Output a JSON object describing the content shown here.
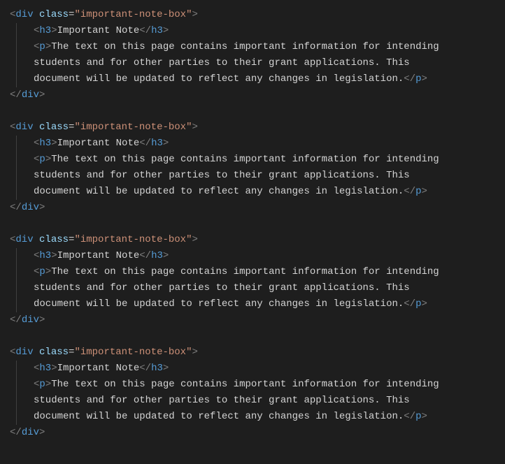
{
  "tags": {
    "div": "div",
    "h3": "h3",
    "p": "p"
  },
  "attrs": {
    "class": "class"
  },
  "strings": {
    "important_note_box": "\"important-note-box\""
  },
  "content": {
    "heading": "Important Note",
    "line1": "The text on this page contains important information for intending",
    "line2": "students and for other parties to their grant applications. This",
    "line3": "document will be updated to reflect any changes in legislation."
  },
  "punct": {
    "open": "<",
    "close": ">",
    "openSlash": "</",
    "slashClose": ">",
    "eq": "="
  }
}
